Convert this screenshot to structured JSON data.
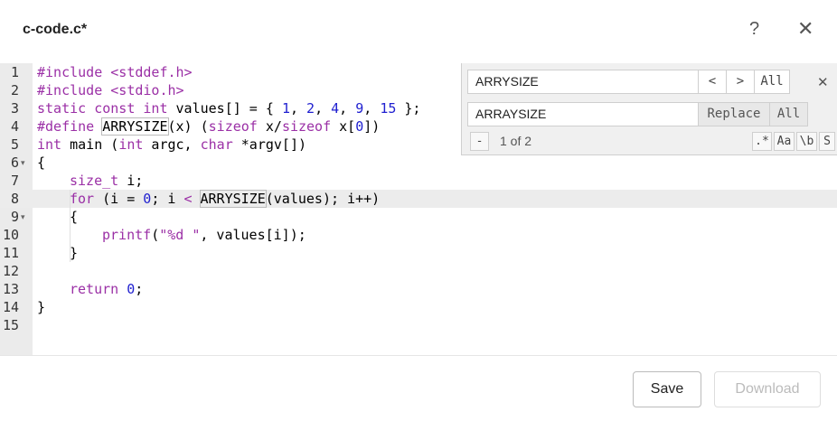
{
  "header": {
    "title": "c-code.c*",
    "help_label": "?",
    "close_label": "✕"
  },
  "editor": {
    "active_line": 8,
    "lines": [
      {
        "n": "1",
        "fold": ""
      },
      {
        "n": "2",
        "fold": ""
      },
      {
        "n": "3",
        "fold": ""
      },
      {
        "n": "4",
        "fold": ""
      },
      {
        "n": "5",
        "fold": ""
      },
      {
        "n": "6",
        "fold": "▾"
      },
      {
        "n": "7",
        "fold": ""
      },
      {
        "n": "8",
        "fold": ""
      },
      {
        "n": "9",
        "fold": "▾"
      },
      {
        "n": "10",
        "fold": ""
      },
      {
        "n": "11",
        "fold": ""
      },
      {
        "n": "12",
        "fold": ""
      },
      {
        "n": "13",
        "fold": ""
      },
      {
        "n": "14",
        "fold": ""
      },
      {
        "n": "15",
        "fold": ""
      }
    ],
    "code": {
      "l1a": "#include <stddef.h>",
      "l2a": "#include <stdio.h>",
      "l3_static": "static",
      "l3_const": "const",
      "l3_int": "int",
      "l3_mid": " values[] = { ",
      "l3_n1": "1",
      "l3_c1": ", ",
      "l3_n2": "2",
      "l3_c2": ", ",
      "l3_n3": "4",
      "l3_c3": ", ",
      "l3_n4": "9",
      "l3_c4": ", ",
      "l3_n5": "15",
      "l3_end": " };",
      "l4_def": "#define ",
      "l4_name": "ARRYSIZE",
      "l4_rest1": "(x) (",
      "l4_sizeof1": "sizeof",
      "l4_x": " x/",
      "l4_sizeof2": "sizeof",
      "l4_rest2": " x[",
      "l4_zero": "0",
      "l4_end": "])",
      "l5_int": "int",
      "l5_a": " main (",
      "l5_int2": "int",
      "l5_b": " argc, ",
      "l5_char": "char",
      "l5_c": " *argv[])",
      "l6": "{",
      "l7_type": "size_t",
      "l7_rest": " i;",
      "l8_for": "for",
      "l8_a": " (i = ",
      "l8_zero": "0",
      "l8_b": "; i ",
      "l8_lt": "<",
      "l8_c": " ",
      "l8_name": "ARRYSIZE",
      "l8_d": "(values); i++)",
      "l9": "{",
      "l10_fn": "printf",
      "l10_a": "(",
      "l10_str": "\"%d \"",
      "l10_b": ", values[i]);",
      "l11": "}",
      "l13_ret": "return",
      "l13_a": " ",
      "l13_zero": "0",
      "l13_b": ";",
      "l14": "}"
    }
  },
  "find": {
    "search_value": "ARRYSIZE",
    "replace_value": "ARRAYSIZE",
    "prev_label": "<",
    "next_label": ">",
    "all_label": "All",
    "close_label": "✕",
    "replace_label": "Replace",
    "replace_all_label": "All",
    "minus_label": "-",
    "count_text": "1 of 2",
    "regex_label": ".*",
    "case_label": "Aa",
    "word_label": "\\b",
    "selection_label": "S"
  },
  "footer": {
    "save_label": "Save",
    "download_label": "Download"
  }
}
